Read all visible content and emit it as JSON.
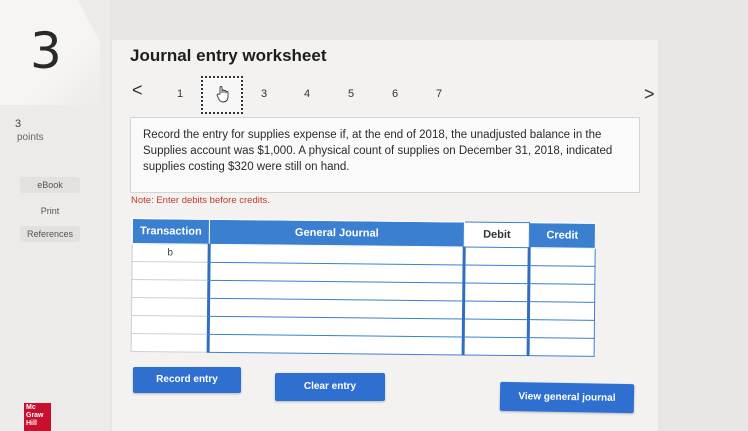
{
  "question": {
    "number": "3",
    "points_value": "3",
    "points_label": "points"
  },
  "sidebar": {
    "links": [
      {
        "label": "eBook"
      },
      {
        "label": "Print"
      },
      {
        "label": "References"
      }
    ]
  },
  "logo": {
    "lines": [
      "Mc",
      "Graw",
      "Hill"
    ],
    "color": "#c8102e"
  },
  "worksheet": {
    "title": "Journal entry worksheet",
    "nav": {
      "prev": "<",
      "next": ">",
      "pages": [
        "1",
        "2",
        "3",
        "4",
        "5",
        "6",
        "7"
      ],
      "current": "2"
    },
    "prompt": "Record the entry for supplies expense if, at the end of 2018, the unadjusted balance in the Supplies account was $1,000. A physical count of supplies on December 31, 2018, indicated supplies costing $320 were still on hand.",
    "note": "Note: Enter debits before credits.",
    "table": {
      "headers": {
        "transaction": "Transaction",
        "general_journal": "General Journal",
        "debit": "Debit",
        "credit": "Credit"
      },
      "rows": [
        {
          "transaction": "b"
        },
        {
          "transaction": ""
        },
        {
          "transaction": ""
        },
        {
          "transaction": ""
        },
        {
          "transaction": ""
        },
        {
          "transaction": ""
        }
      ]
    },
    "buttons": {
      "record": "Record entry",
      "clear": "Clear entry",
      "view": "View general journal"
    }
  },
  "colors": {
    "accent": "#2f6fd0",
    "header": "#3b7fd0",
    "note": "#c0392b"
  }
}
